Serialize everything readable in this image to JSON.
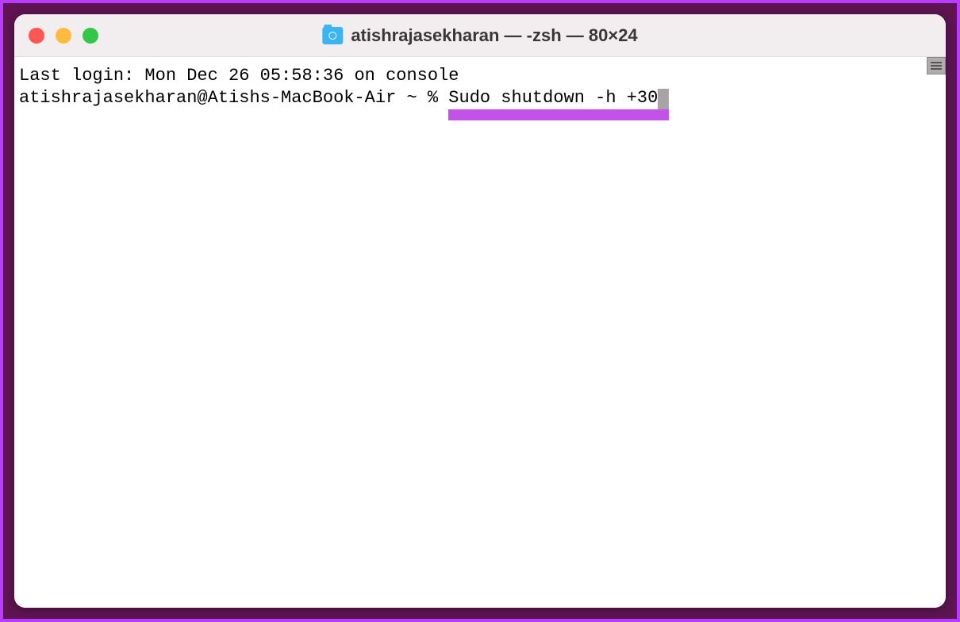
{
  "window": {
    "title": "atishrajasekharan — -zsh — 80×24"
  },
  "terminal": {
    "last_login": "Last login: Mon Dec 26 05:58:36 on console",
    "prompt": "atishrajasekharan@Atishs-MacBook-Air ~ % ",
    "command": "Sudo shutdown -h +30"
  },
  "colors": {
    "highlight": "#c252e8",
    "border": "#b83cff",
    "background": "#5d1451"
  }
}
